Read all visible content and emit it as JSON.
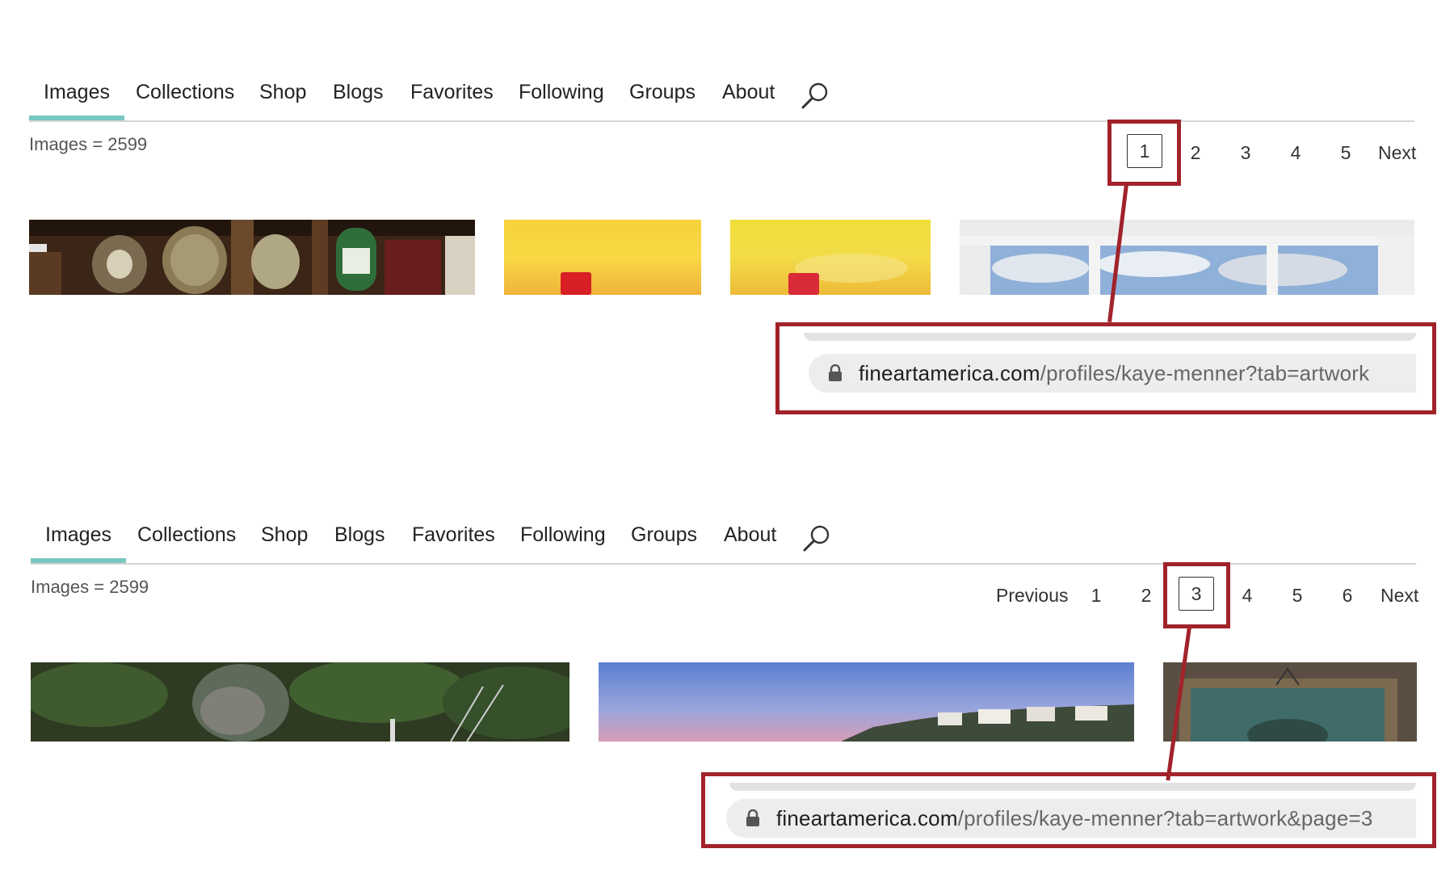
{
  "panels": [
    {
      "tabs": [
        "Images",
        "Collections",
        "Shop",
        "Blogs",
        "Favorites",
        "Following",
        "Groups",
        "About"
      ],
      "active_tab": "Images",
      "image_count": "Images = 2599",
      "pagination": {
        "previous": "",
        "pages": [
          "1",
          "2",
          "3",
          "4",
          "5"
        ],
        "current": "1",
        "next": "Next"
      },
      "url": {
        "host": "fineartamerica.com",
        "path": "/profiles/kaye-menner?tab=artwork"
      }
    },
    {
      "tabs": [
        "Images",
        "Collections",
        "Shop",
        "Blogs",
        "Favorites",
        "Following",
        "Groups",
        "About"
      ],
      "active_tab": "Images",
      "image_count": "Images = 2599",
      "pagination": {
        "previous": "Previous",
        "pages": [
          "1",
          "2",
          "3",
          "4",
          "5",
          "6"
        ],
        "current": "3",
        "next": "Next"
      },
      "url": {
        "host": "fineartamerica.com",
        "path": "/profiles/kaye-menner?tab=artwork&page=3"
      }
    }
  ],
  "colors": {
    "callout": "#a1232a",
    "active_tab_underline": "#79c7c1"
  },
  "icons": [
    "search-icon",
    "lock-icon"
  ]
}
